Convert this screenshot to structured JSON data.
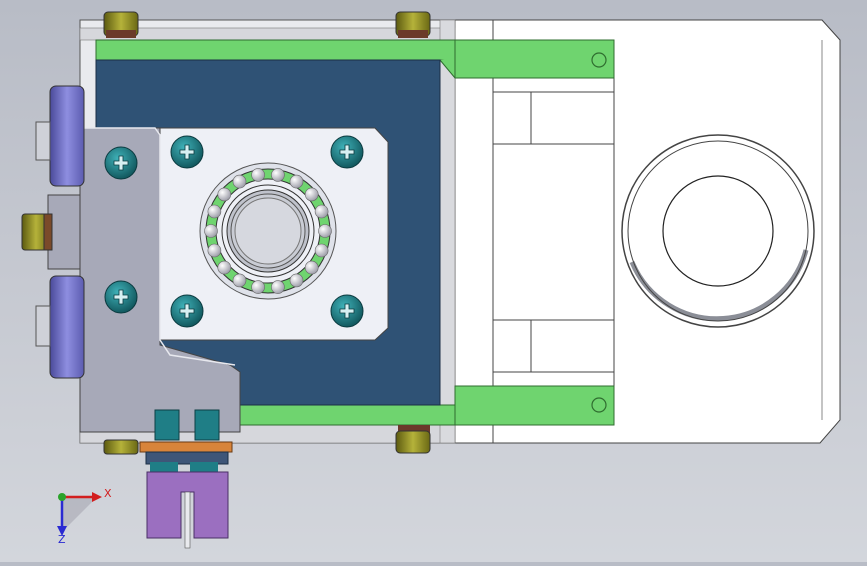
{
  "viewport": {
    "background_top": "#b8bcc6",
    "background_bottom": "#d3d6dc"
  },
  "colors": {
    "green": "#6fd46f",
    "dark_blue_plate": "#2f5275",
    "bracket_gray": "#a7a9b8",
    "motor_face": "#eef0f6",
    "screw_teal": "#1f7e86",
    "knob_lavender": "#7d7dcc",
    "bushing_olive": "#8a8a22",
    "clamp_purple": "#9b6fc0",
    "clamp_orange": "#d8843a",
    "axis_x": "#d21e1e",
    "axis_y": "#2aa32a",
    "axis_z": "#2a2ad2"
  },
  "triad": {
    "x_label": "X",
    "z_label": "Z"
  }
}
